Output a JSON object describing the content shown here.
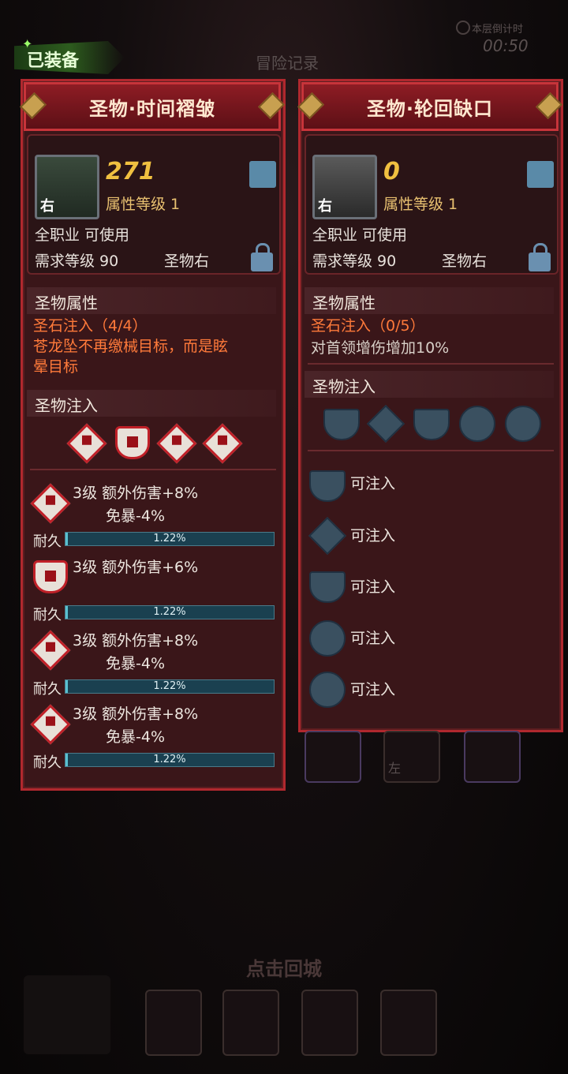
{
  "top": {
    "tab_title": "冒险记录",
    "timer_label": "本层倒计时",
    "timer_value": "00:50",
    "equipped": "已装备"
  },
  "left": {
    "title": "圣物·时间褶皱",
    "score": "271",
    "attr_level": "属性等级 1",
    "side_tag": "右",
    "class_req": "全职业 可使用",
    "level_req": "需求等级 90",
    "slot_label": "圣物右",
    "attr_section": "圣物属性",
    "stone_inject": "圣石注入（4/4）",
    "effect_line1": "苍龙坠不再缴械目标，而是眩",
    "effect_line2": "晕目标",
    "inject_section": "圣物注入",
    "gems": [
      "III",
      "III",
      "III",
      "III"
    ],
    "entries": [
      {
        "line1": "3级 额外伤害+8%",
        "line2": "免暴-4%",
        "dur_label": "耐久",
        "dur": "1.22%",
        "dur_value": 0.0122
      },
      {
        "line1": "3级 额外伤害+6%",
        "line2": "",
        "dur_label": "耐久",
        "dur": "1.22%",
        "dur_value": 0.0122
      },
      {
        "line1": "3级 额外伤害+8%",
        "line2": "免暴-4%",
        "dur_label": "耐久",
        "dur": "1.22%",
        "dur_value": 0.0122
      },
      {
        "line1": "3级 额外伤害+8%",
        "line2": "免暴-4%",
        "dur_label": "耐久",
        "dur": "1.22%",
        "dur_value": 0.0122
      }
    ]
  },
  "right": {
    "title": "圣物·轮回缺口",
    "score": "0",
    "attr_level": "属性等级 1",
    "side_tag": "右",
    "class_req": "全职业 可使用",
    "level_req": "需求等级 90",
    "slot_label": "圣物右",
    "attr_section": "圣物属性",
    "stone_inject": "圣石注入（0/5）",
    "effect_line1": "对首领增伤增加10%",
    "inject_section": "圣物注入",
    "slots": [
      "可注入",
      "可注入",
      "可注入",
      "可注入",
      "可注入"
    ]
  },
  "bottom": {
    "behind_tag": "左",
    "return_city": "点击回城"
  },
  "colors": {
    "frame": "#b0282e",
    "panel": "#3a1619",
    "orange": "#ff7a3a",
    "gold": "#f0c040"
  }
}
